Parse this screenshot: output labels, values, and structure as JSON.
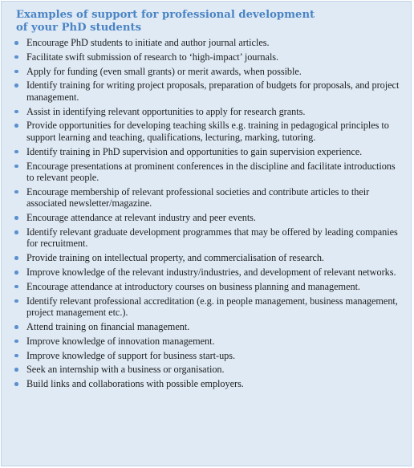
{
  "panel": {
    "title_line1": "Examples of support for professional development",
    "title_line2": "of your PhD students",
    "accent_color": "#4a84c4",
    "bullet_color": "#5b90cf",
    "background_color": "#dfeaf5",
    "items": [
      "Encourage PhD students to initiate and author journal articles.",
      "Facilitate swift submission of research to ‘high-impact’ journals.",
      "Apply for funding (even small grants) or merit awards, when possible.",
      "Identify training for writing project proposals, preparation of budgets for proposals, and project management.",
      "Assist in identifying relevant opportunities to apply for research grants.",
      "Provide opportunities for developing teaching skills e.g. training in pedagogical principles to support learning and teaching, qualifications, lecturing, marking, tutoring.",
      "Identify training in PhD supervision and opportunities to gain supervision experience.",
      "Encourage presentations at prominent conferences in the discipline and facilitate introductions to relevant people.",
      "Encourage membership of relevant professional societies and contribute articles to their associated newsletter/magazine.",
      "Encourage attendance at relevant industry and peer events.",
      "Identify relevant graduate development programmes that may be offered by leading companies for recruitment.",
      "Provide training on intellectual property, and commercialisation of research.",
      "Improve knowledge of the relevant industry/industries, and development of relevant networks.",
      "Encourage attendance at introductory courses on business planning and management.",
      "Identify relevant professional accreditation (e.g. in people management, business management, project management etc.).",
      "Attend training on financial management.",
      "Improve knowledge of innovation management.",
      "Improve knowledge of support for business start-ups.",
      "Seek an internship with a business or organisation.",
      "Build links and collaborations with possible employers."
    ]
  }
}
